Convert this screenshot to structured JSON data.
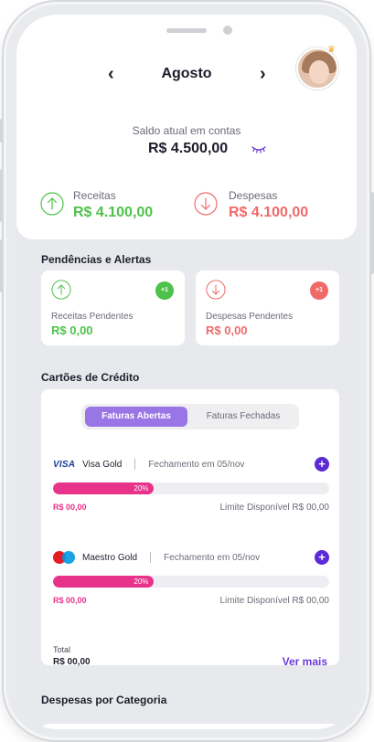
{
  "header": {
    "month": "Agosto",
    "prev_icon": "chevron-left-icon",
    "next_icon": "chevron-right-icon",
    "avatar_icon": "user-avatar",
    "crown_icon": "crown-icon"
  },
  "balance": {
    "label": "Saldo atual em contas",
    "value": "R$ 4.500,00",
    "toggle_icon": "eye-closed-icon",
    "accent": "#6b3ad9"
  },
  "summary": {
    "income": {
      "label": "Receitas",
      "value": "R$ 4.100,00",
      "color": "#4ec24a",
      "icon": "arrow-up-circle-icon"
    },
    "expense": {
      "label": "Despesas",
      "value": "R$ 4.100,00",
      "color": "#f06a6a",
      "icon": "arrow-down-circle-icon"
    }
  },
  "pending": {
    "title": "Pendências e Alertas",
    "cards": [
      {
        "label": "Receitas Pendentes",
        "value": "R$ 0,00",
        "badge": "+1",
        "color": "#4ec24a",
        "icon": "arrow-up-circle-icon"
      },
      {
        "label": "Despesas Pendentes",
        "value": "R$ 0,00",
        "badge": "+1",
        "color": "#f06a6a",
        "icon": "arrow-down-circle-icon"
      }
    ]
  },
  "credit_cards": {
    "title": "Cartões de Crédito",
    "tabs": {
      "open": "Faturas Abertas",
      "closed": "Faturas Fechadas",
      "active": "open"
    },
    "cards": [
      {
        "brand_icon": "visa-logo",
        "brand_text": "VISA",
        "name": "Visa Gold",
        "closing": "Fechamento em 05/nov",
        "progress_label": "20%",
        "progress": 0.2,
        "amount": "R$ 00,00",
        "limit": "Limite Disponível R$ 00,00"
      },
      {
        "brand_icon": "maestro-logo",
        "name": "Maestro Gold",
        "closing": "Fechamento em 05/nov",
        "progress_label": "20%",
        "progress": 0.2,
        "amount": "R$ 00,00",
        "limit": "Limite Disponível R$ 00,00"
      }
    ],
    "total_label": "Total",
    "total_value": "R$ 00,00",
    "see_more": "Ver mais",
    "bar_color": "#e8338b"
  },
  "categories": {
    "title": "Despesas por Categoria"
  }
}
